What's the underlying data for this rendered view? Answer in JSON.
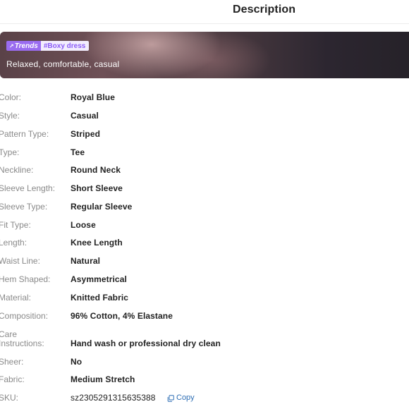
{
  "header": {
    "title": "Description"
  },
  "banner": {
    "tag_trends": "Trends",
    "tag_hashtag": "#Boxy dress",
    "subtitle": "Relaxed, comfortable, casual"
  },
  "specs": [
    {
      "label": "Color:",
      "value": "Royal Blue"
    },
    {
      "label": "Style:",
      "value": "Casual"
    },
    {
      "label": "Pattern Type:",
      "value": "Striped"
    },
    {
      "label": "Type:",
      "value": "Tee"
    },
    {
      "label": "Neckline:",
      "value": "Round Neck"
    },
    {
      "label": "Sleeve Length:",
      "value": "Short Sleeve"
    },
    {
      "label": "Sleeve Type:",
      "value": "Regular Sleeve"
    },
    {
      "label": "Fit Type:",
      "value": "Loose"
    },
    {
      "label": "Length:",
      "value": "Knee Length"
    },
    {
      "label": "Waist Line:",
      "value": "Natural"
    },
    {
      "label": "Hem Shaped:",
      "value": "Asymmetrical"
    },
    {
      "label": "Material:",
      "value": "Knitted Fabric"
    },
    {
      "label": "Composition:",
      "value": "96% Cotton, 4% Elastane"
    },
    {
      "label_line1": "Care",
      "label_line2": "Instructions:",
      "value": "Hand wash or professional dry clean"
    },
    {
      "label": "Sheer:",
      "value": "No"
    },
    {
      "label": "Fabric:",
      "value": "Medium Stretch"
    },
    {
      "label": "SKU:",
      "value": "sz2305291315635388"
    }
  ],
  "copy_label": "Copy",
  "colors": {
    "accent_purple": "#9a6cf0",
    "copy_blue": "#2f6fb5"
  },
  "icons": {
    "copy": "copy-icon",
    "trends": "trend-arrow-icon"
  }
}
